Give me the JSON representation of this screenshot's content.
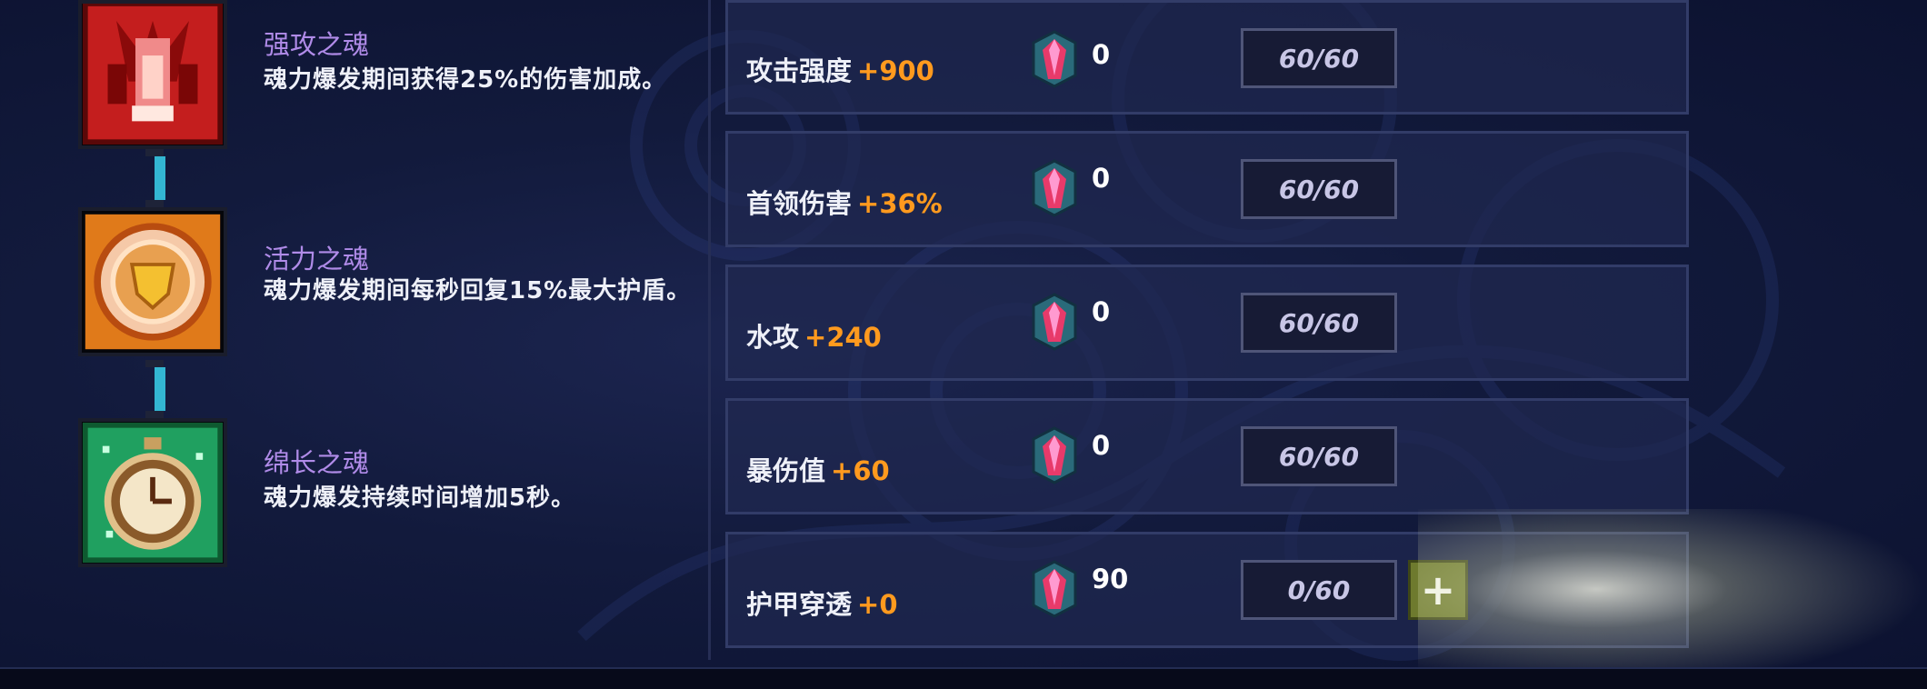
{
  "skills": [
    {
      "name": "强攻之魂",
      "desc": "魂力爆发期间获得25%的伤害加成。",
      "icon": "fist-icon"
    },
    {
      "name": "活力之魂",
      "desc": "魂力爆发期间每秒回复15%最大护盾。",
      "icon": "shield-emblem-icon"
    },
    {
      "name": "绵长之魂",
      "desc": "魂力爆发持续时间增加5秒。",
      "icon": "stopwatch-icon"
    }
  ],
  "stats": [
    {
      "label": "攻击强度",
      "value": "+900",
      "gem_count": "0",
      "level": "60/60"
    },
    {
      "label": "首领伤害",
      "value": "+36%",
      "gem_count": "0",
      "level": "60/60"
    },
    {
      "label": "水攻",
      "value": "+240",
      "gem_count": "0",
      "level": "60/60"
    },
    {
      "label": "暴伤值",
      "value": "+60",
      "gem_count": "0",
      "level": "60/60"
    },
    {
      "label": "护甲穿透",
      "value": "+0",
      "gem_count": "90",
      "level": "0/60",
      "upgrade_label": "+"
    }
  ],
  "colors": {
    "skill_name": "#b08be8",
    "stat_value": "#ff9a1e",
    "connector": "#33b6d2",
    "upgrade_button": "#6e7a2e"
  }
}
